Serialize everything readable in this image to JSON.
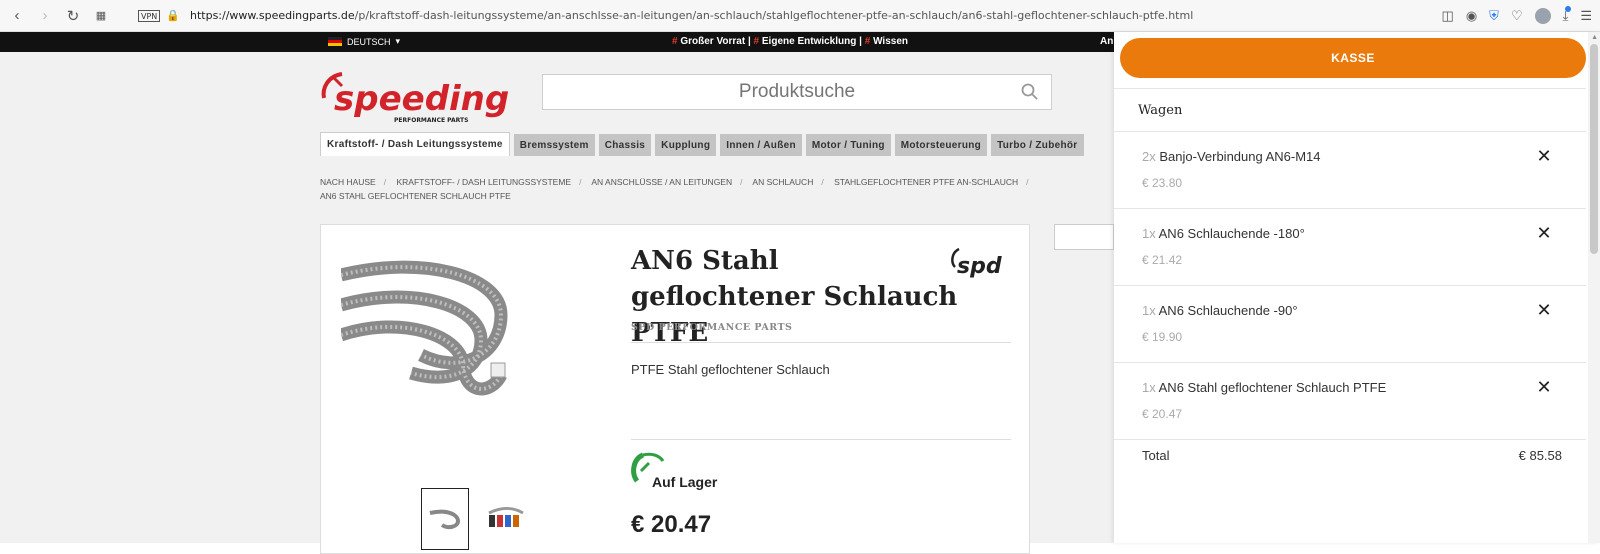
{
  "browser": {
    "url_domain": "https://www.speedingparts.de",
    "url_path": "/p/kraftstoff-dash-leitungssysteme/an-anschlsse-an-leitungen/an-schlauch/stahlgeflochtener-ptfe-an-schlauch/an6-stahl-geflochtener-schlauch-ptfe.html",
    "vpn_label": "VPN"
  },
  "topbar": {
    "language": "DEUTSCH",
    "promo_1": "Großer Vorrat",
    "promo_2": "Eigene Entwicklung",
    "promo_3": "Wissen",
    "hash": "#",
    "pipe": " | ",
    "extra": "An"
  },
  "logo": {
    "text": "speeding",
    "sub": "PERFORMANCE PARTS"
  },
  "search": {
    "placeholder": "Produktsuche"
  },
  "categories": [
    "Kraftstoff- / Dash Leitungssysteme",
    "Bremssystem",
    "Chassis",
    "Kupplung",
    "Innen / Außen",
    "Motor / Tuning",
    "Motorsteuerung",
    "Turbo / Zubehör"
  ],
  "breadcrumb": [
    "Nach Hause",
    "Kraftstoff- / Dash Leitungssysteme",
    "An Anschlüsse / An Leitungen",
    "An Schlauch",
    "Stahlgeflochtener PTFE An-Schlauch",
    "AN6 Stahl geflochtener Schlauch PTFE"
  ],
  "product": {
    "title": "AN6 Stahl geflochtener Schlauch PTFE",
    "brand": "SPD PERFORMANCE PARTS",
    "brand_logo": "spd",
    "description": "PTFE Stahl geflochtener Schlauch",
    "stock": "Auf Lager",
    "price": "€ 20.47"
  },
  "cart": {
    "checkout_label": "KASSE",
    "title": "Wagen",
    "items": [
      {
        "qty": "2x",
        "name": "Banjo-Verbindung AN6-M14",
        "price": "€ 23.80"
      },
      {
        "qty": "1x",
        "name": "AN6 Schlauchende -180°",
        "price": "€ 21.42"
      },
      {
        "qty": "1x",
        "name": "AN6 Schlauchende -90°",
        "price": "€ 19.90"
      },
      {
        "qty": "1x",
        "name": "AN6 Stahl geflochtener Schlauch PTFE",
        "price": "€ 20.47"
      }
    ],
    "total_label": "Total",
    "total_value": "€ 85.58",
    "remove_glyph": "✕"
  },
  "colors": {
    "accent": "#ea7a0c",
    "logo_red": "#d2232a",
    "stock_green": "#2ea043",
    "promo_hash": "#e53b2c"
  }
}
